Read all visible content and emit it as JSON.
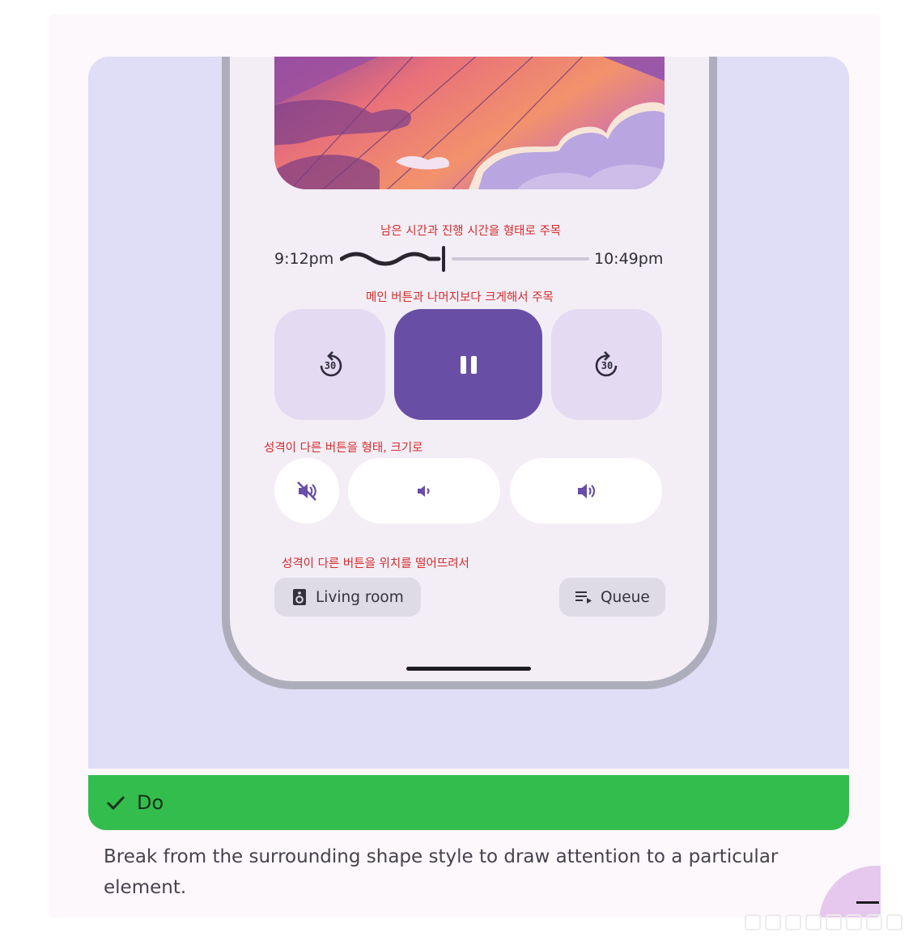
{
  "notes": {
    "time": "남은 시간과 진행 시간을 형태로 주목",
    "main_button": "메인 버튼과 나머지보다 크게해서 주목",
    "button_shape": "성격이 다른 버튼을 형태, 크기로",
    "button_position": "성격이 다른 버튼을 위치를 떨어뜨려서"
  },
  "player": {
    "elapsed": "9:12pm",
    "end": "10:49pm",
    "progress": 0.39,
    "skip_back_seconds": "30",
    "skip_forward_seconds": "30",
    "state": "playing"
  },
  "chips": {
    "device_label": "Living room",
    "queue_label": "Queue"
  },
  "do_bar": {
    "label": "Do"
  },
  "caption": "Break from the surrounding shape style to draw attention to a particular element.",
  "colors": {
    "accent": "#684fa5",
    "do_green": "#33bd4d",
    "annotation_red": "#d62b2b"
  },
  "icons": [
    "replay-30-icon",
    "pause-icon",
    "forward-30-icon",
    "volume-off-icon",
    "volume-down-icon",
    "volume-up-icon",
    "speaker-icon",
    "queue-icon",
    "check-icon"
  ]
}
